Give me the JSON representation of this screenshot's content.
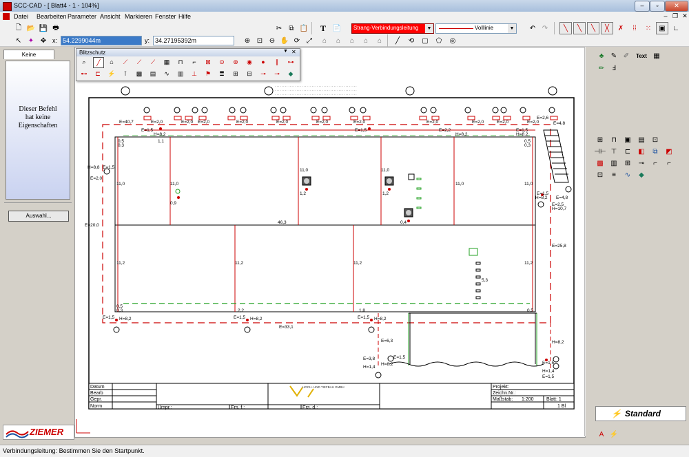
{
  "window": {
    "title": "SCC-CAD - [ Blatt4 - 1 - 104%]"
  },
  "menu": [
    "Datei",
    "Bearbeiten",
    "Parameter",
    "Ansicht",
    "Markieren",
    "Fenster",
    "Hilfe"
  ],
  "toolbar": {
    "x_label": "x:",
    "x_value": "54.2299044m",
    "y_label": "y:",
    "y_value": "34.27195392m",
    "layer": "Strang-Verbindungsleitung",
    "linetype": "Volllinie"
  },
  "colors": {
    "layer_red": "#e00000",
    "drawing_red": "#c00000",
    "green": "#20a020",
    "panel_blue": "#c9d2f0"
  },
  "left_panel": {
    "tab": "Keine Eigenschaften",
    "message_lines": [
      "Dieser Befehl",
      "hat keine",
      "Eigenschaften"
    ],
    "select_button": "Auswahl..."
  },
  "float_toolbar": {
    "title": "Blitzschutz"
  },
  "drawing": {
    "labels": {
      "e407": "E=40,7",
      "e20a": "E=2,0",
      "e15": "E=1,5",
      "h82": "H=8,2",
      "h88": "H=8,8",
      "e200": "E=20,0",
      "v110": "11,0",
      "v112": "11,2",
      "v09": "0,9",
      "v12": "1,2",
      "v04": "0,4",
      "v463": "46,3",
      "v53": "5,3",
      "v18": "1,8",
      "v22": "2,2",
      "v11": "1,1",
      "v05": "0,5",
      "v03": "0,3",
      "e331": "E=33,1",
      "e63": "E=6,3",
      "e38": "E=3,8",
      "h14": "H=1,4",
      "e48": "E=4,8",
      "e25": "E=2,5",
      "h107": "H=10,7",
      "e258": "E=25,8",
      "e22": "E=2,2",
      "e26": "E=2,6"
    },
    "titleblock": {
      "datum": "Datum",
      "bearb": "Bearb",
      "gepr": "Gepr.",
      "norm": "Norm",
      "urspr": "Urspr.:",
      "ersf": "Ers. f.:",
      "ersd": "Ers. d.:",
      "company": "HOCH- UND TIEFBAU GMBH",
      "projekt": "Projekt:",
      "zeichn": "Zeichn.Nr.:",
      "massstab": "Maßstab:",
      "scale": "1:200",
      "blatt": "Blatt: 1",
      "bl": "1 Bl"
    }
  },
  "right_panel": {
    "standard": "Standard",
    "text_icon": "Text"
  },
  "logo": {
    "name": "ZIEMER"
  },
  "status": {
    "message": "Verbindungsleitung: Bestimmen Sie den Startpunkt."
  }
}
